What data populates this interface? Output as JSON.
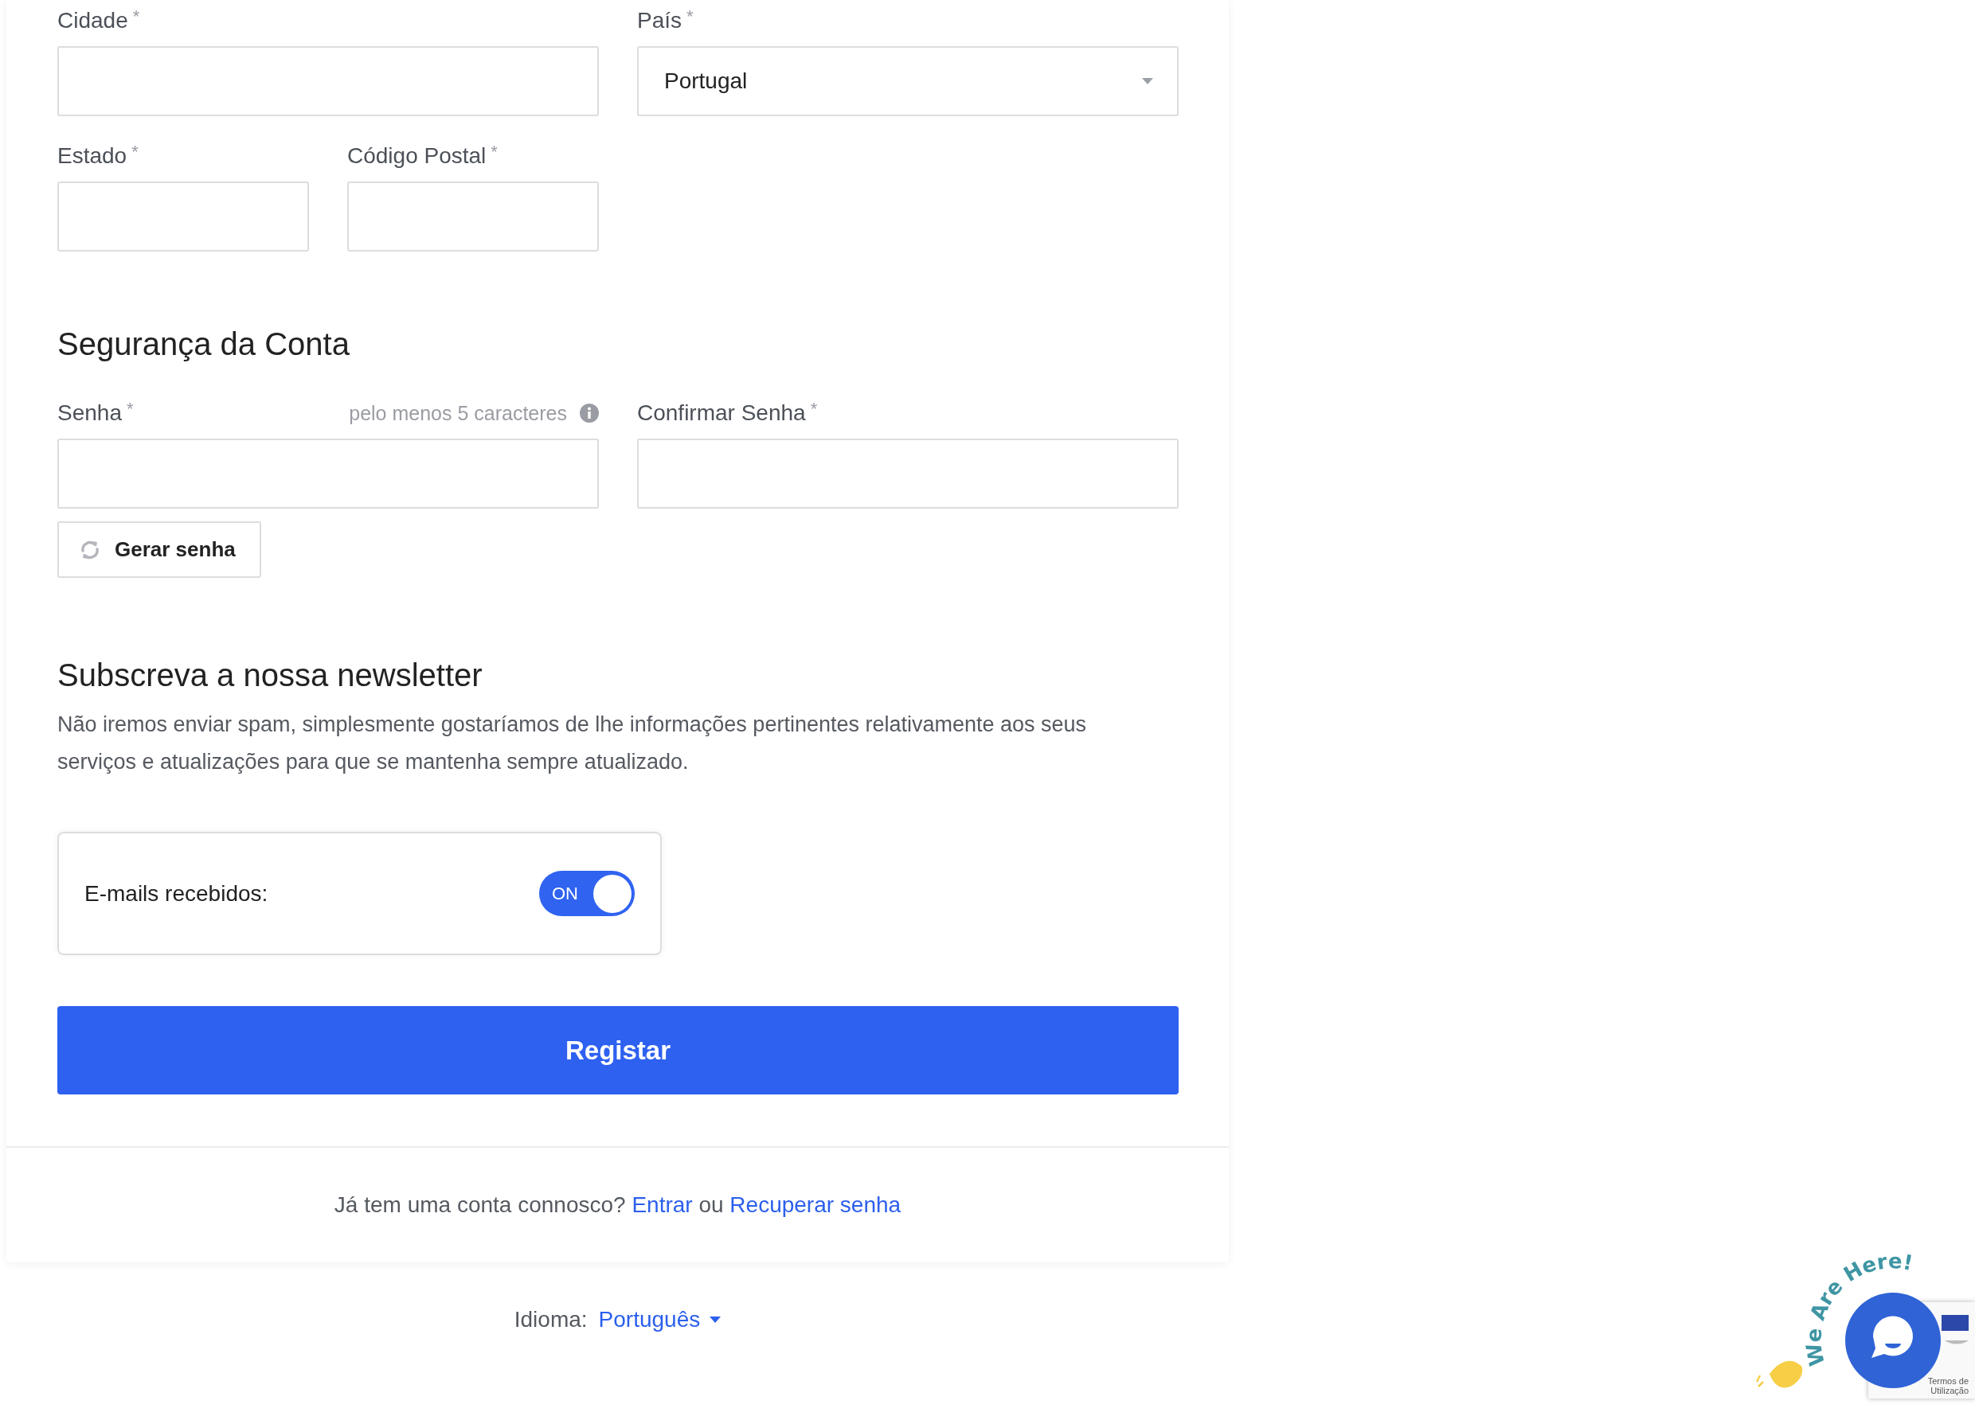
{
  "required_mark": "*",
  "address_fields": [
    {
      "label": "Cidade",
      "required": true,
      "kind": "text"
    },
    {
      "label": "País",
      "required": true,
      "kind": "select",
      "value": "Portugal"
    },
    {
      "label": "Estado",
      "required": true,
      "kind": "text"
    },
    {
      "label": "Código Postal",
      "required": true,
      "kind": "text"
    }
  ],
  "security": {
    "heading": "Segurança da Conta",
    "fields": [
      {
        "label": "Senha",
        "required": true,
        "hint": "pelo menos 5 caracteres"
      },
      {
        "label": "Confirmar Senha",
        "required": true
      }
    ],
    "generate_button": "Gerar senha"
  },
  "newsletter": {
    "heading": "Subscreva a nossa newsletter",
    "text": "Não iremos enviar spam, simplesmente gostaríamos de lhe informações pertinentes relativamente aos seus serviços e atualizações para que se mantenha sempre atualizado.",
    "toggle": {
      "label": "E-mails recebidos:",
      "on": true,
      "state_label": "ON"
    }
  },
  "submit_button": "Registar",
  "account_prompt": {
    "text": "Já tem uma conta connosco?",
    "login_link": "Entrar",
    "separator": "ou",
    "recover_link": "Recuperar senha"
  },
  "language": {
    "label": "Idioma:",
    "value": "Português"
  },
  "chat_widget": {
    "tagline": "We Are Here!"
  },
  "recaptcha": {
    "text": "Termos de Utilização"
  }
}
